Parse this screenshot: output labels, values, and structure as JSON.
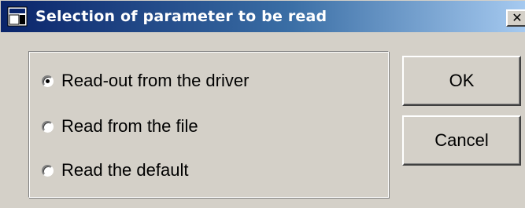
{
  "window": {
    "title": "Selection of parameter to be read",
    "close_glyph": "✕",
    "icon": "app-window-icon"
  },
  "options": [
    {
      "label": "Read-out from the driver",
      "selected": true
    },
    {
      "label": "Read from the file",
      "selected": false
    },
    {
      "label": "Read the default",
      "selected": false
    }
  ],
  "buttons": {
    "ok_label": "OK",
    "cancel_label": "Cancel"
  },
  "colors": {
    "face": "#d4d0c8",
    "title_start": "#0a246a",
    "title_end": "#a6caf0"
  }
}
